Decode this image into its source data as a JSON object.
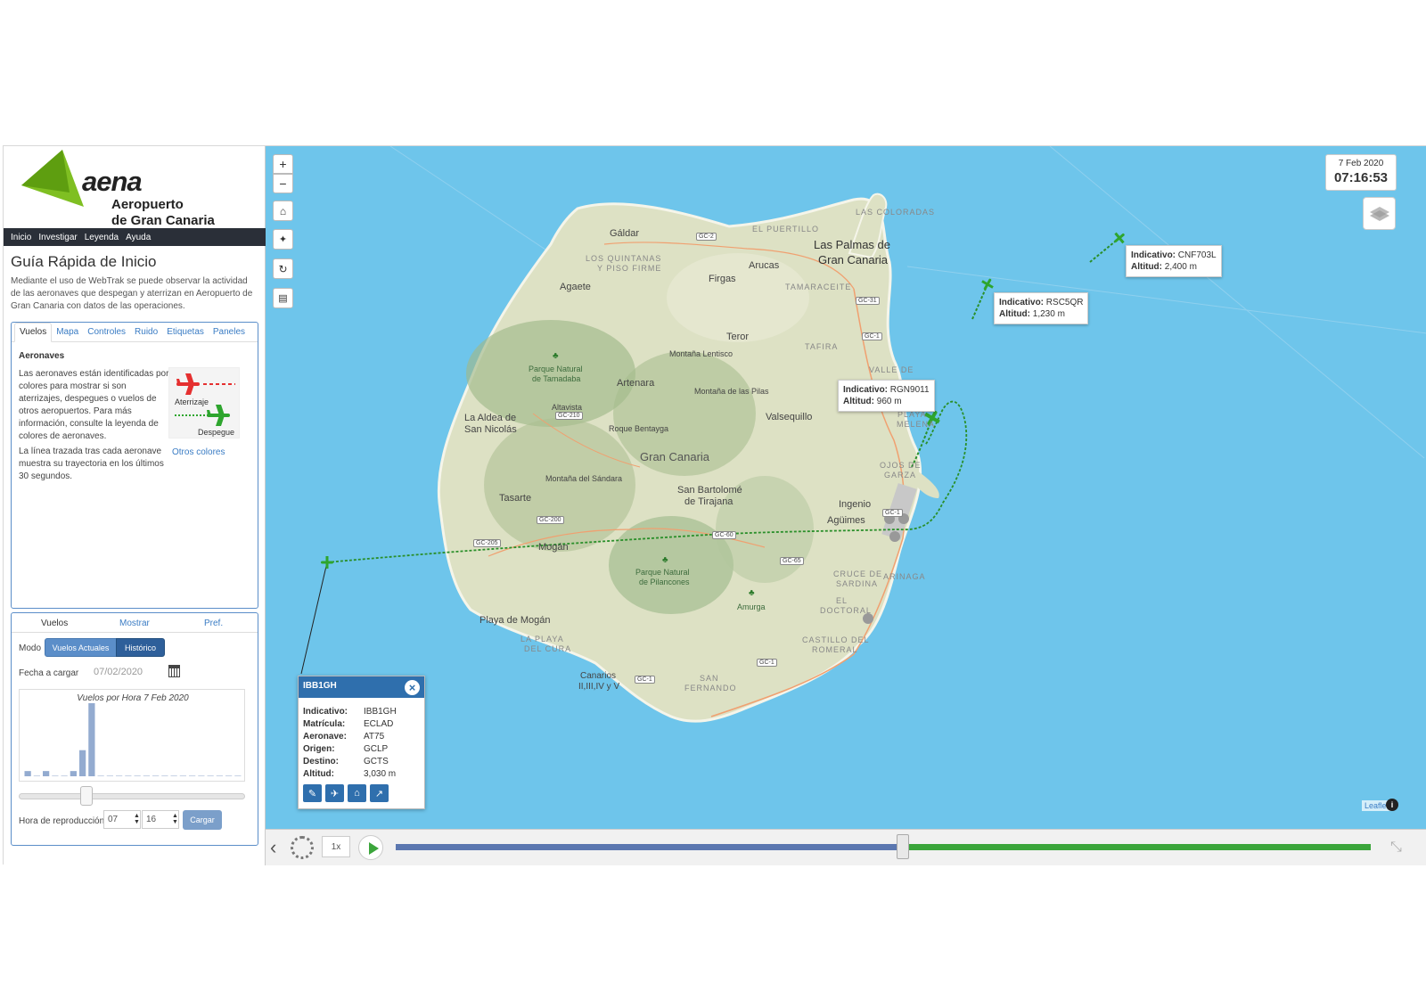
{
  "brand": {
    "word": "aena",
    "line1": "Aeropuerto",
    "line2": "de Gran Canaria"
  },
  "nav": [
    "Inicio",
    "Investigar",
    "Leyenda",
    "Ayuda"
  ],
  "guide": {
    "title": "Guía Rápida de Inicio",
    "intro": "Mediante el uso de WebTrak se puede observar la actividad de las aeronaves que despegan y aterrizan en Aeropuerto de Gran Canaria con datos de las operaciones.",
    "tabs": [
      "Vuelos",
      "Mapa",
      "Controles",
      "Ruido",
      "Etiquetas",
      "Paneles"
    ],
    "active_tab": "Vuelos",
    "aero_heading": "Aeronaves",
    "aero_text": "Las aeronaves están identificadas por colores para mostrar si son aterrizajes, despegues o vuelos de otros aeropuertos. Para más información, consulte la leyenda de colores de aeronaves.",
    "legend_landing": "Aterrizaje",
    "legend_takeoff": "Despegue",
    "trail_text": "La línea trazada tras cada aeronave muestra su trayectoria en los últimos 30 segundos.",
    "other_colors": "Otros colores"
  },
  "controls": {
    "tabs": [
      "Vuelos",
      "Mostrar",
      "Pref."
    ],
    "mode_label": "Modo",
    "mode_current": "Vuelos Actuales",
    "mode_history": "Histórico",
    "date_label": "Fecha a cargar",
    "date_value": "07/02/2020",
    "histogram_title": "Vuelos por Hora 7 Feb 2020",
    "histogram_values": [
      1,
      0,
      1,
      0,
      0,
      1,
      5,
      14,
      0,
      0,
      0,
      0,
      0,
      0,
      0,
      0,
      0,
      0,
      0,
      0,
      0,
      0,
      0,
      0
    ],
    "slider_fraction": 0.3,
    "hour_label": "Hora de reproducción",
    "hour": "07",
    "minute": "16",
    "load_button": "Cargar"
  },
  "map": {
    "date": "7 Feb 2020",
    "time": "07:16:53",
    "labels": {
      "galdar": "Gáldar",
      "las_palmas_1": "Las Palmas de",
      "las_palmas_2": "Gran Canaria",
      "las_colorados": "LAS COLORADAS",
      "el_puertillo": "EL PUERTILLO",
      "quintanas_1": "LOS QUINTANAS",
      "quintanas_2": "Y PISO FIRME",
      "arucas": "Arucas",
      "agaete": "Agaete",
      "firgas": "Firgas",
      "tamaraceite": "TAMARACEITE",
      "teror": "Teror",
      "tafira": "TAFIRA",
      "montana_lentisco": "Montaña Lentisco",
      "valle": "VALLE DE",
      "tamadaba_1": "Parque Natural",
      "tamadaba_2": "de Tamadaba",
      "artenara": "Artenara",
      "pilas": "Montaña de las Pilas",
      "altavista": "Altavista",
      "aldea_1": "La Aldea de",
      "aldea_2": "San Nicolás",
      "bentayga": "Roque Bentayga",
      "valsequillo": "Valsequillo",
      "playa_melenara_1": "PLAYA",
      "playa_melenara_2": "MELENA",
      "gran_canaria": "Gran Canaria",
      "ojos_1": "OJOS DE",
      "ojos_2": "GARZA",
      "sandara": "Montaña del Sándara",
      "bartolome_1": "San Bartolomé",
      "bartolome_2": "de Tirajana",
      "tasarte": "Tasarte",
      "ingenio": "Ingenio",
      "aguimes": "Agüimes",
      "mogan": "Mogán",
      "pilancones_1": "Parque Natural",
      "pilancones_2": "de Pilancones",
      "cruce_1": "CRUCE DE",
      "cruce_2": "SARDINA",
      "arinaga": "ARINAGA",
      "amurga": "Amurga",
      "playa_mogan": "Playa de Mogán",
      "doctoral_1": "EL",
      "doctoral_2": "DOCTORAL",
      "cura_1": "LA PLAYA",
      "cura_2": "DEL CURA",
      "castillo_1": "CASTILLO DEL",
      "castillo_2": "ROMERAL",
      "canarios_1": "Canarios",
      "canarios_2": "II,III,IV y V",
      "fernando_1": "SAN",
      "fernando_2": "FERNANDO"
    },
    "roads": [
      "GC-2",
      "GC-31",
      "GC-1",
      "GC-210",
      "GC-200",
      "GC-205",
      "GC-60",
      "GC-65",
      "GC-1",
      "GC-1",
      "GC-1"
    ],
    "tooltips": [
      {
        "indicativo_label": "Indicativo:",
        "indicativo": "CNF703L",
        "altitud_label": "Altitud:",
        "altitud": "2,400 m"
      },
      {
        "indicativo_label": "Indicativo:",
        "indicativo": "RSC5QR",
        "altitud_label": "Altitud:",
        "altitud": "1,230 m"
      },
      {
        "indicativo_label": "Indicativo:",
        "indicativo": "RGN9011",
        "altitud_label": "Altitud:",
        "altitud": "960 m"
      }
    ],
    "popup": {
      "title": "IBB1GH",
      "rows": [
        {
          "k": "Indicativo:",
          "v": "IBB1GH"
        },
        {
          "k": "Matrícula:",
          "v": "ECLAD"
        },
        {
          "k": "Aeronave:",
          "v": "AT75"
        },
        {
          "k": "Origen:",
          "v": "GCLP"
        },
        {
          "k": "Destino:",
          "v": "GCTS"
        },
        {
          "k": "Altitud:",
          "v": "3,030 m"
        }
      ]
    },
    "attribution": "Leaflet",
    "colors": {
      "sea": "#6ec5eb",
      "land": "#dfe3c6",
      "takeoff": "#2ea52e",
      "landing": "#e53030",
      "accent": "#2f6fad"
    }
  },
  "playback": {
    "speed": "1x",
    "progress": 0.52
  }
}
